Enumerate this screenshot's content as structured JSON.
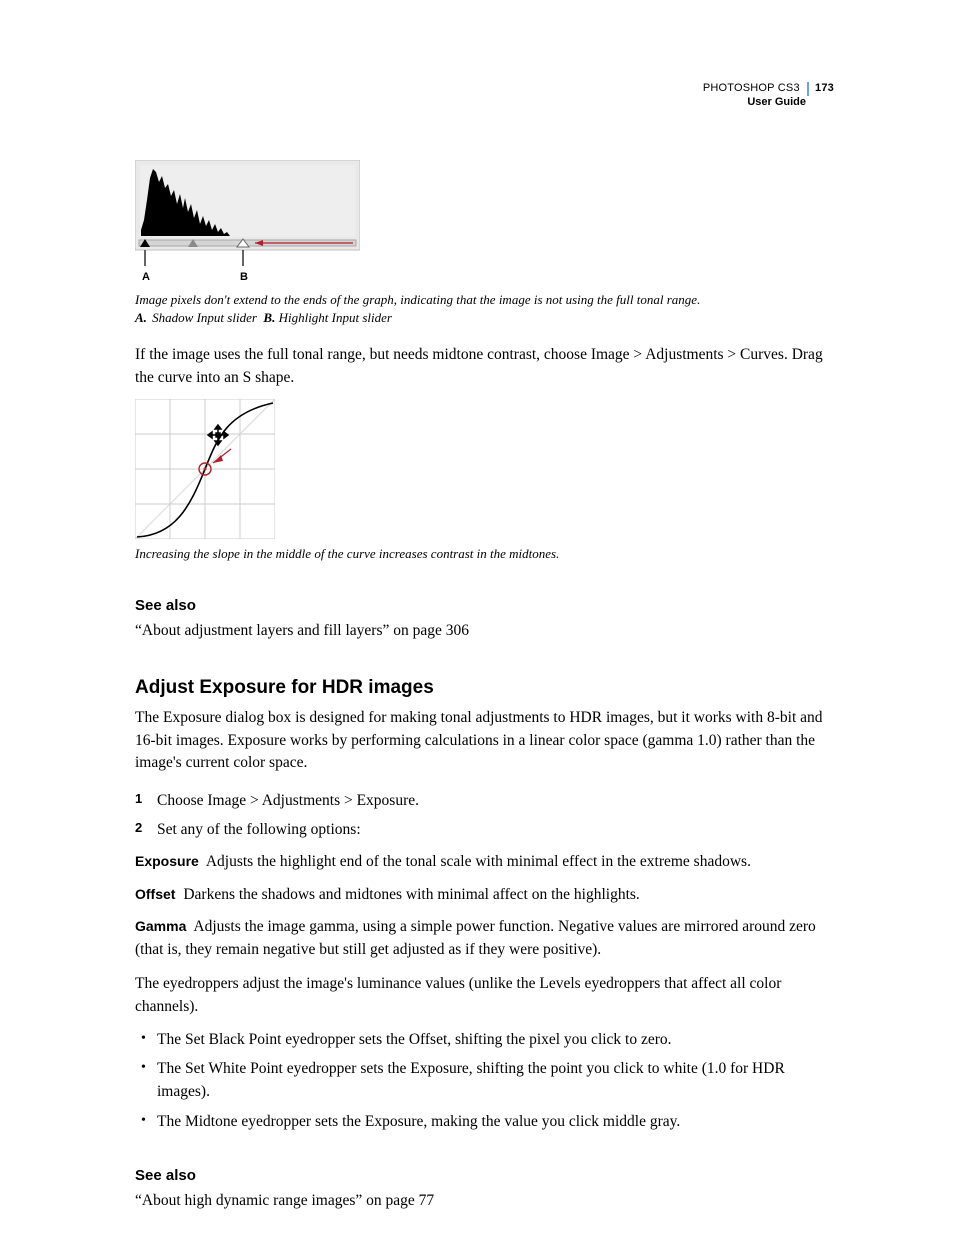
{
  "runhead": {
    "product": "PHOTOSHOP CS3",
    "page": "173",
    "sub": "User Guide"
  },
  "fig1": {
    "label_a": "A",
    "label_b": "B",
    "caption_main": "Image pixels don't extend to the ends of the graph, indicating that the image is not using the full tonal range.",
    "a_lbl": "A.",
    "a_txt": "Shadow Input slider",
    "b_lbl": "B.",
    "b_txt": "Highlight Input slider"
  },
  "para1": "If the image uses the full tonal range, but needs midtone contrast, choose Image > Adjustments > Curves. Drag the curve into an S shape.",
  "fig2": {
    "caption": "Increasing the slope in the middle of the curve increases contrast in the midtones."
  },
  "seeAlso1": {
    "heading": "See also",
    "xref": "“About adjustment layers and fill layers” on page 306"
  },
  "section": {
    "heading": "Adjust Exposure for HDR images",
    "intro": "The Exposure dialog box is designed for making tonal adjustments to HDR images, but it works with 8-bit and 16-bit images. Exposure works by performing calculations in a linear color space (gamma 1.0) rather than the image's current color space."
  },
  "steps": [
    {
      "n": "1",
      "t": "Choose Image > Adjustments > Exposure."
    },
    {
      "n": "2",
      "t": "Set any of the following options:"
    }
  ],
  "defs": {
    "exposure_t": "Exposure",
    "exposure": "Adjusts the highlight end of the tonal scale with minimal effect in the extreme shadows.",
    "offset_t": "Offset",
    "offset": "Darkens the shadows and midtones with minimal affect on the highlights.",
    "gamma_t": "Gamma",
    "gamma": "Adjusts the image gamma, using a simple power function. Negative values are mirrored around zero (that is, they remain negative but still get adjusted as if they were positive)."
  },
  "para2": "The eyedroppers adjust the image's luminance values (unlike the Levels eyedroppers that affect all color channels).",
  "bullets": [
    "The Set Black Point eyedropper sets the Offset, shifting the pixel you click to zero.",
    "The Set White Point eyedropper sets the Exposure, shifting the point you click to white (1.0 for HDR images).",
    "The Midtone eyedropper sets the Exposure, making the value you click middle gray."
  ],
  "seeAlso2": {
    "heading": "See also",
    "xref": "“About high dynamic range images” on page 77"
  }
}
